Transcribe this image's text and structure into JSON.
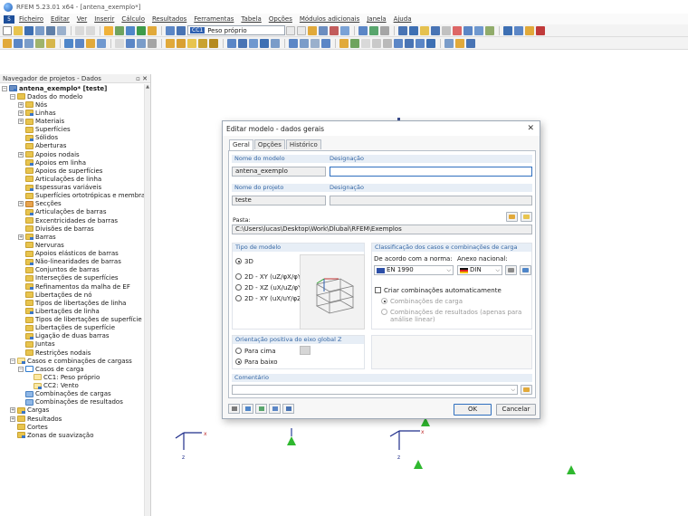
{
  "window": {
    "title": "RFEM 5.23.01 x64 - [antena_exemplo*]"
  },
  "menu": [
    "Ficheiro",
    "Editar",
    "Ver",
    "Inserir",
    "Cálculo",
    "Resultados",
    "Ferramentas",
    "Tabela",
    "Opções",
    "Módulos adicionais",
    "Janela",
    "Ajuda"
  ],
  "toolbar": {
    "load_case_chip": "CC1",
    "load_case_name": "Peso próprio"
  },
  "navigator": {
    "title": "Navegador de projetos - Dados",
    "pin": "▫ ✕",
    "tree": [
      {
        "label": "antena_exemplo* [teste]",
        "level": 0,
        "toggle": "−",
        "icon": "model",
        "bold": true
      },
      {
        "label": "Dados do modelo",
        "level": 1,
        "toggle": "−",
        "icon": "folder"
      },
      {
        "label": "Nós",
        "level": 2,
        "toggle": "+",
        "icon": "folder"
      },
      {
        "label": "Linhas",
        "level": 2,
        "toggle": "+",
        "icon": "folder"
      },
      {
        "label": "Materiais",
        "level": 2,
        "toggle": "+",
        "icon": "folder"
      },
      {
        "label": "Superfícies",
        "level": 2,
        "toggle": "",
        "icon": "folder"
      },
      {
        "label": "Sólidos",
        "level": 2,
        "toggle": "",
        "icon": "folder"
      },
      {
        "label": "Aberturas",
        "level": 2,
        "toggle": "",
        "icon": "folder"
      },
      {
        "label": "Apoios nodais",
        "level": 2,
        "toggle": "+",
        "icon": "folder"
      },
      {
        "label": "Apoios em linha",
        "level": 2,
        "toggle": "",
        "icon": "folder"
      },
      {
        "label": "Apoios de superfícies",
        "level": 2,
        "toggle": "",
        "icon": "folder"
      },
      {
        "label": "Articulações de linha",
        "level": 2,
        "toggle": "",
        "icon": "folder"
      },
      {
        "label": "Espessuras variáveis",
        "level": 2,
        "toggle": "",
        "icon": "folder"
      },
      {
        "label": "Superfícies ortotrópicas e membra",
        "level": 2,
        "toggle": "",
        "icon": "folder"
      },
      {
        "label": "Secções",
        "level": 2,
        "toggle": "+",
        "icon": "sect"
      },
      {
        "label": "Articulações de barras",
        "level": 2,
        "toggle": "",
        "icon": "folder"
      },
      {
        "label": "Excentricidades de barras",
        "level": 2,
        "toggle": "",
        "icon": "folder"
      },
      {
        "label": "Divisões de barras",
        "level": 2,
        "toggle": "",
        "icon": "folder"
      },
      {
        "label": "Barras",
        "level": 2,
        "toggle": "+",
        "icon": "folder"
      },
      {
        "label": "Nervuras",
        "level": 2,
        "toggle": "",
        "icon": "folder"
      },
      {
        "label": "Apoios elásticos de barras",
        "level": 2,
        "toggle": "",
        "icon": "folder"
      },
      {
        "label": "Não-linearidades de barras",
        "level": 2,
        "toggle": "",
        "icon": "folder"
      },
      {
        "label": "Conjuntos de barras",
        "level": 2,
        "toggle": "",
        "icon": "folder"
      },
      {
        "label": "Interseções de superfícies",
        "level": 2,
        "toggle": "",
        "icon": "folder"
      },
      {
        "label": "Refinamentos da malha de EF",
        "level": 2,
        "toggle": "",
        "icon": "folder"
      },
      {
        "label": "Libertações de nó",
        "level": 2,
        "toggle": "",
        "icon": "folder"
      },
      {
        "label": "Tipos de libertações de linha",
        "level": 2,
        "toggle": "",
        "icon": "folder"
      },
      {
        "label": "Libertações de linha",
        "level": 2,
        "toggle": "",
        "icon": "folder"
      },
      {
        "label": "Tipos de libertações de superfície",
        "level": 2,
        "toggle": "",
        "icon": "folder"
      },
      {
        "label": "Libertações de superfície",
        "level": 2,
        "toggle": "",
        "icon": "folder"
      },
      {
        "label": "Ligação de duas barras",
        "level": 2,
        "toggle": "",
        "icon": "folder"
      },
      {
        "label": "Juntas",
        "level": 2,
        "toggle": "",
        "icon": "folder"
      },
      {
        "label": "Restrições nodais",
        "level": 2,
        "toggle": "",
        "icon": "folder"
      },
      {
        "label": "Casos e combinações de cargass",
        "level": 1,
        "toggle": "−",
        "icon": "load"
      },
      {
        "label": "Casos de carga",
        "level": 2,
        "toggle": "−",
        "icon": "lc"
      },
      {
        "label": "CC1: Peso próprio",
        "level": 3,
        "toggle": "",
        "icon": "load"
      },
      {
        "label": "CC2: Vento",
        "level": 3,
        "toggle": "",
        "icon": "load"
      },
      {
        "label": "Combinações de cargas",
        "level": 2,
        "toggle": "",
        "icon": "combo"
      },
      {
        "label": "Combinações de resultados",
        "level": 2,
        "toggle": "",
        "icon": "combo"
      },
      {
        "label": "Cargas",
        "level": 1,
        "toggle": "+",
        "icon": "folder"
      },
      {
        "label": "Resultados",
        "level": 1,
        "toggle": "+",
        "icon": "folder"
      },
      {
        "label": "Cortes",
        "level": 1,
        "toggle": "",
        "icon": "folder"
      },
      {
        "label": "Zonas de suavização",
        "level": 1,
        "toggle": "",
        "icon": "folder"
      }
    ]
  },
  "dialog": {
    "title": "Editar modelo - dados gerais",
    "close": "✕",
    "tabs": [
      "Geral",
      "Opções",
      "Histórico"
    ],
    "model_name_label": "Nome do modelo",
    "model_name": "antena_exemplo",
    "model_desc_label": "Designação",
    "model_desc": "",
    "project_name_label": "Nome do projeto",
    "project_name": "teste",
    "project_desc_label": "Designação",
    "project_desc": "",
    "folder_label": "Pasta:",
    "folder": "C:\\Users\\lucas\\Desktop\\Work\\Dlubal\\RFEM\\Exemplos",
    "model_type_header": "Tipo de modelo",
    "model_types": [
      "3D",
      "2D - XY (uZ/φX/φY)",
      "2D - XZ (uX/uZ/φY)",
      "2D - XY (uX/uY/φZ)"
    ],
    "model_type_selected": 0,
    "classification_header": "Classificação dos casos e combinações de carga",
    "norm_label": "De acordo com a norma:",
    "norm_value": "EN 1990",
    "annex_label": "Anexo nacional:",
    "annex_value": "DIN",
    "auto_combo_label": "Criar combinações automaticamente",
    "combo_loads_label": "Combinações de carga",
    "combo_results_label": "Combinações de resultados (apenas para análise linear)",
    "orientation_header": "Orientação positiva do eixo global Z",
    "orientation_options": [
      "Para cima",
      "Para baixo"
    ],
    "orientation_selected": 1,
    "comment_header": "Comentário",
    "comment": "",
    "ok_label": "OK",
    "cancel_label": "Cancelar"
  }
}
